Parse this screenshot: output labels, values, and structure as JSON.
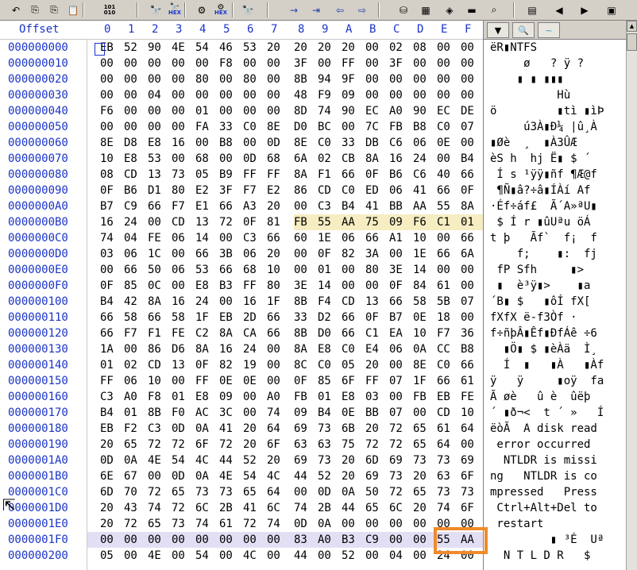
{
  "toolbar": {
    "icons": [
      "undo-icon",
      "copy-icon",
      "copy-hex-icon",
      "paste-icon",
      "binary-icon",
      "find-icon",
      "find-hex-icon",
      "replace-icon",
      "replace-hex-icon",
      "find-next-icon",
      "goto-offset-icon",
      "goto-import-icon",
      "back-icon",
      "forward-icon",
      "disk-open-icon",
      "memory-icon",
      "drive-icon",
      "image-icon",
      "search-icon",
      "calc-icon",
      "prev-icon",
      "next-icon",
      "snapshot-icon"
    ],
    "binary_top": "101",
    "binary_bottom": "010",
    "hex_label": "HEX"
  },
  "header": {
    "offset_label": "Offset",
    "columns": [
      "0",
      "1",
      "2",
      "3",
      "4",
      "5",
      "6",
      "7",
      "8",
      "9",
      "A",
      "B",
      "C",
      "D",
      "E",
      "F"
    ]
  },
  "rows": [
    {
      "offset": "000000000",
      "hex": [
        "EB",
        "52",
        "90",
        "4E",
        "54",
        "46",
        "53",
        "20",
        "20",
        "20",
        "20",
        "00",
        "02",
        "08",
        "00",
        "00"
      ],
      "text": "ëR▮NTFS"
    },
    {
      "offset": "000000010",
      "hex": [
        "00",
        "00",
        "00",
        "00",
        "00",
        "F8",
        "00",
        "00",
        "3F",
        "00",
        "FF",
        "00",
        "3F",
        "00",
        "00",
        "00"
      ],
      "text": "     ø   ? ÿ ?"
    },
    {
      "offset": "000000020",
      "hex": [
        "00",
        "00",
        "00",
        "00",
        "80",
        "00",
        "80",
        "00",
        "8B",
        "94",
        "9F",
        "00",
        "00",
        "00",
        "00",
        "00"
      ],
      "text": "    ▮ ▮ ▮▮▮"
    },
    {
      "offset": "000000030",
      "hex": [
        "00",
        "00",
        "04",
        "00",
        "00",
        "00",
        "00",
        "00",
        "48",
        "F9",
        "09",
        "00",
        "00",
        "00",
        "00",
        "00"
      ],
      "text": "          Hù"
    },
    {
      "offset": "000000040",
      "hex": [
        "F6",
        "00",
        "00",
        "00",
        "01",
        "00",
        "00",
        "00",
        "8D",
        "74",
        "90",
        "EC",
        "A0",
        "90",
        "EC",
        "DE"
      ],
      "text": "ö         ▮tì ▮ìÞ"
    },
    {
      "offset": "000000050",
      "hex": [
        "00",
        "00",
        "00",
        "00",
        "FA",
        "33",
        "C0",
        "8E",
        "D0",
        "BC",
        "00",
        "7C",
        "FB",
        "B8",
        "C0",
        "07"
      ],
      "text": "     ú3À▮Ð¼ |û¸À"
    },
    {
      "offset": "000000060",
      "hex": [
        "8E",
        "D8",
        "E8",
        "16",
        "00",
        "B8",
        "00",
        "0D",
        "8E",
        "C0",
        "33",
        "DB",
        "C6",
        "06",
        "0E",
        "00"
      ],
      "text": "▮Øè  ¸  ▮À3ÛÆ"
    },
    {
      "offset": "000000070",
      "hex": [
        "10",
        "E8",
        "53",
        "00",
        "68",
        "00",
        "0D",
        "68",
        "6A",
        "02",
        "CB",
        "8A",
        "16",
        "24",
        "00",
        "B4"
      ],
      "text": "èS h  hj Ë▮ $ ´"
    },
    {
      "offset": "000000080",
      "hex": [
        "08",
        "CD",
        "13",
        "73",
        "05",
        "B9",
        "FF",
        "FF",
        "8A",
        "F1",
        "66",
        "0F",
        "B6",
        "C6",
        "40",
        "66"
      ],
      "text": " Í s ¹ÿÿ▮ñf ¶Æ@f"
    },
    {
      "offset": "000000090",
      "hex": [
        "0F",
        "B6",
        "D1",
        "80",
        "E2",
        "3F",
        "F7",
        "E2",
        "86",
        "CD",
        "C0",
        "ED",
        "06",
        "41",
        "66",
        "0F"
      ],
      "text": " ¶Ñ▮â?÷â▮ÍÀí Af"
    },
    {
      "offset": "0000000A0",
      "hex": [
        "B7",
        "C9",
        "66",
        "F7",
        "E1",
        "66",
        "A3",
        "20",
        "00",
        "C3",
        "B4",
        "41",
        "BB",
        "AA",
        "55",
        "8A"
      ],
      "text": "·Éf÷áf£  Ã´A»ªU▮"
    },
    {
      "offset": "0000000B0",
      "hex": [
        "16",
        "24",
        "00",
        "CD",
        "13",
        "72",
        "0F",
        "81",
        "FB",
        "55",
        "AA",
        "75",
        "09",
        "F6",
        "C1",
        "01"
      ],
      "text": " $ Í r ▮ûUªu öÁ"
    },
    {
      "offset": "0000000C0",
      "hex": [
        "74",
        "04",
        "FE",
        "06",
        "14",
        "00",
        "C3",
        "66",
        "60",
        "1E",
        "06",
        "66",
        "A1",
        "10",
        "00",
        "66"
      ],
      "text": "t þ   Ãf`  f¡  f"
    },
    {
      "offset": "0000000D0",
      "hex": [
        "03",
        "06",
        "1C",
        "00",
        "66",
        "3B",
        "06",
        "20",
        "00",
        "0F",
        "82",
        "3A",
        "00",
        "1E",
        "66",
        "6A"
      ],
      "text": "    f;    ▮:  fj"
    },
    {
      "offset": "0000000E0",
      "hex": [
        "00",
        "66",
        "50",
        "06",
        "53",
        "66",
        "68",
        "10",
        "00",
        "01",
        "00",
        "80",
        "3E",
        "14",
        "00",
        "00"
      ],
      "text": " fP Sfh     ▮>"
    },
    {
      "offset": "0000000F0",
      "hex": [
        "0F",
        "85",
        "0C",
        "00",
        "E8",
        "B3",
        "FF",
        "80",
        "3E",
        "14",
        "00",
        "00",
        "0F",
        "84",
        "61",
        "00"
      ],
      "text": " ▮  è³ÿ▮>    ▮a"
    },
    {
      "offset": "000000100",
      "hex": [
        "B4",
        "42",
        "8A",
        "16",
        "24",
        "00",
        "16",
        "1F",
        "8B",
        "F4",
        "CD",
        "13",
        "66",
        "58",
        "5B",
        "07"
      ],
      "text": "´B▮ $   ▮ôÍ fX["
    },
    {
      "offset": "000000110",
      "hex": [
        "66",
        "58",
        "66",
        "58",
        "1F",
        "EB",
        "2D",
        "66",
        "33",
        "D2",
        "66",
        "0F",
        "B7",
        "0E",
        "18",
        "00"
      ],
      "text": "fXfX ë-f3Òf ·"
    },
    {
      "offset": "000000120",
      "hex": [
        "66",
        "F7",
        "F1",
        "FE",
        "C2",
        "8A",
        "CA",
        "66",
        "8B",
        "D0",
        "66",
        "C1",
        "EA",
        "10",
        "F7",
        "36"
      ],
      "text": "f÷ñþÂ▮Êf▮ÐfÁê ÷6"
    },
    {
      "offset": "000000130",
      "hex": [
        "1A",
        "00",
        "86",
        "D6",
        "8A",
        "16",
        "24",
        "00",
        "8A",
        "E8",
        "C0",
        "E4",
        "06",
        "0A",
        "CC",
        "B8"
      ],
      "text": "  ▮Ö▮ $ ▮èÀä  Ì¸"
    },
    {
      "offset": "000000140",
      "hex": [
        "01",
        "02",
        "CD",
        "13",
        "0F",
        "82",
        "19",
        "00",
        "8C",
        "C0",
        "05",
        "20",
        "00",
        "8E",
        "C0",
        "66"
      ],
      "text": "  Í  ▮   ▮À   ▮Àf"
    },
    {
      "offset": "000000150",
      "hex": [
        "FF",
        "06",
        "10",
        "00",
        "FF",
        "0E",
        "0E",
        "00",
        "0F",
        "85",
        "6F",
        "FF",
        "07",
        "1F",
        "66",
        "61"
      ],
      "text": "ÿ   ÿ     ▮oÿ  fa"
    },
    {
      "offset": "000000160",
      "hex": [
        "C3",
        "A0",
        "F8",
        "01",
        "E8",
        "09",
        "00",
        "A0",
        "FB",
        "01",
        "E8",
        "03",
        "00",
        "FB",
        "EB",
        "FE"
      ],
      "text": "Ã øè   û è  ûëþ"
    },
    {
      "offset": "000000170",
      "hex": [
        "B4",
        "01",
        "8B",
        "F0",
        "AC",
        "3C",
        "00",
        "74",
        "09",
        "B4",
        "0E",
        "BB",
        "07",
        "00",
        "CD",
        "10"
      ],
      "text": "´ ▮ð¬<  t ´ »   Í"
    },
    {
      "offset": "000000180",
      "hex": [
        "EB",
        "F2",
        "C3",
        "0D",
        "0A",
        "41",
        "20",
        "64",
        "69",
        "73",
        "6B",
        "20",
        "72",
        "65",
        "61",
        "64"
      ],
      "text": "ëòÃ  A disk read"
    },
    {
      "offset": "000000190",
      "hex": [
        "20",
        "65",
        "72",
        "72",
        "6F",
        "72",
        "20",
        "6F",
        "63",
        "63",
        "75",
        "72",
        "72",
        "65",
        "64",
        "00"
      ],
      "text": " error occurred"
    },
    {
      "offset": "0000001A0",
      "hex": [
        "0D",
        "0A",
        "4E",
        "54",
        "4C",
        "44",
        "52",
        "20",
        "69",
        "73",
        "20",
        "6D",
        "69",
        "73",
        "73",
        "69"
      ],
      "text": "  NTLDR is missi"
    },
    {
      "offset": "0000001B0",
      "hex": [
        "6E",
        "67",
        "00",
        "0D",
        "0A",
        "4E",
        "54",
        "4C",
        "44",
        "52",
        "20",
        "69",
        "73",
        "20",
        "63",
        "6F"
      ],
      "text": "ng   NTLDR is co"
    },
    {
      "offset": "0000001C0",
      "hex": [
        "6D",
        "70",
        "72",
        "65",
        "73",
        "73",
        "65",
        "64",
        "00",
        "0D",
        "0A",
        "50",
        "72",
        "65",
        "73",
        "73"
      ],
      "text": "mpressed   Press"
    },
    {
      "offset": "0000001D0",
      "hex": [
        "20",
        "43",
        "74",
        "72",
        "6C",
        "2B",
        "41",
        "6C",
        "74",
        "2B",
        "44",
        "65",
        "6C",
        "20",
        "74",
        "6F"
      ],
      "text": " Ctrl+Alt+Del to"
    },
    {
      "offset": "0000001E0",
      "hex": [
        "20",
        "72",
        "65",
        "73",
        "74",
        "61",
        "72",
        "74",
        "0D",
        "0A",
        "00",
        "00",
        "00",
        "00",
        "00",
        "00"
      ],
      "text": " restart"
    },
    {
      "offset": "0000001F0",
      "hex": [
        "00",
        "00",
        "00",
        "00",
        "00",
        "00",
        "00",
        "00",
        "83",
        "A0",
        "B3",
        "C9",
        "00",
        "00",
        "55",
        "AA"
      ],
      "text": "         ▮ ³É  Uª"
    },
    {
      "offset": "000000200",
      "hex": [
        "05",
        "00",
        "4E",
        "00",
        "54",
        "00",
        "4C",
        "00",
        "44",
        "00",
        "52",
        "00",
        "04",
        "00",
        "24",
        "00"
      ],
      "text": "  N T L D R   $"
    }
  ],
  "highlight": {
    "row_index": 11,
    "from_col": 8
  },
  "selected_row_index": 31,
  "accent_color": "#1a34c8",
  "highlight_color": "#f6edc2",
  "selection_box_color": "#f08a2c"
}
